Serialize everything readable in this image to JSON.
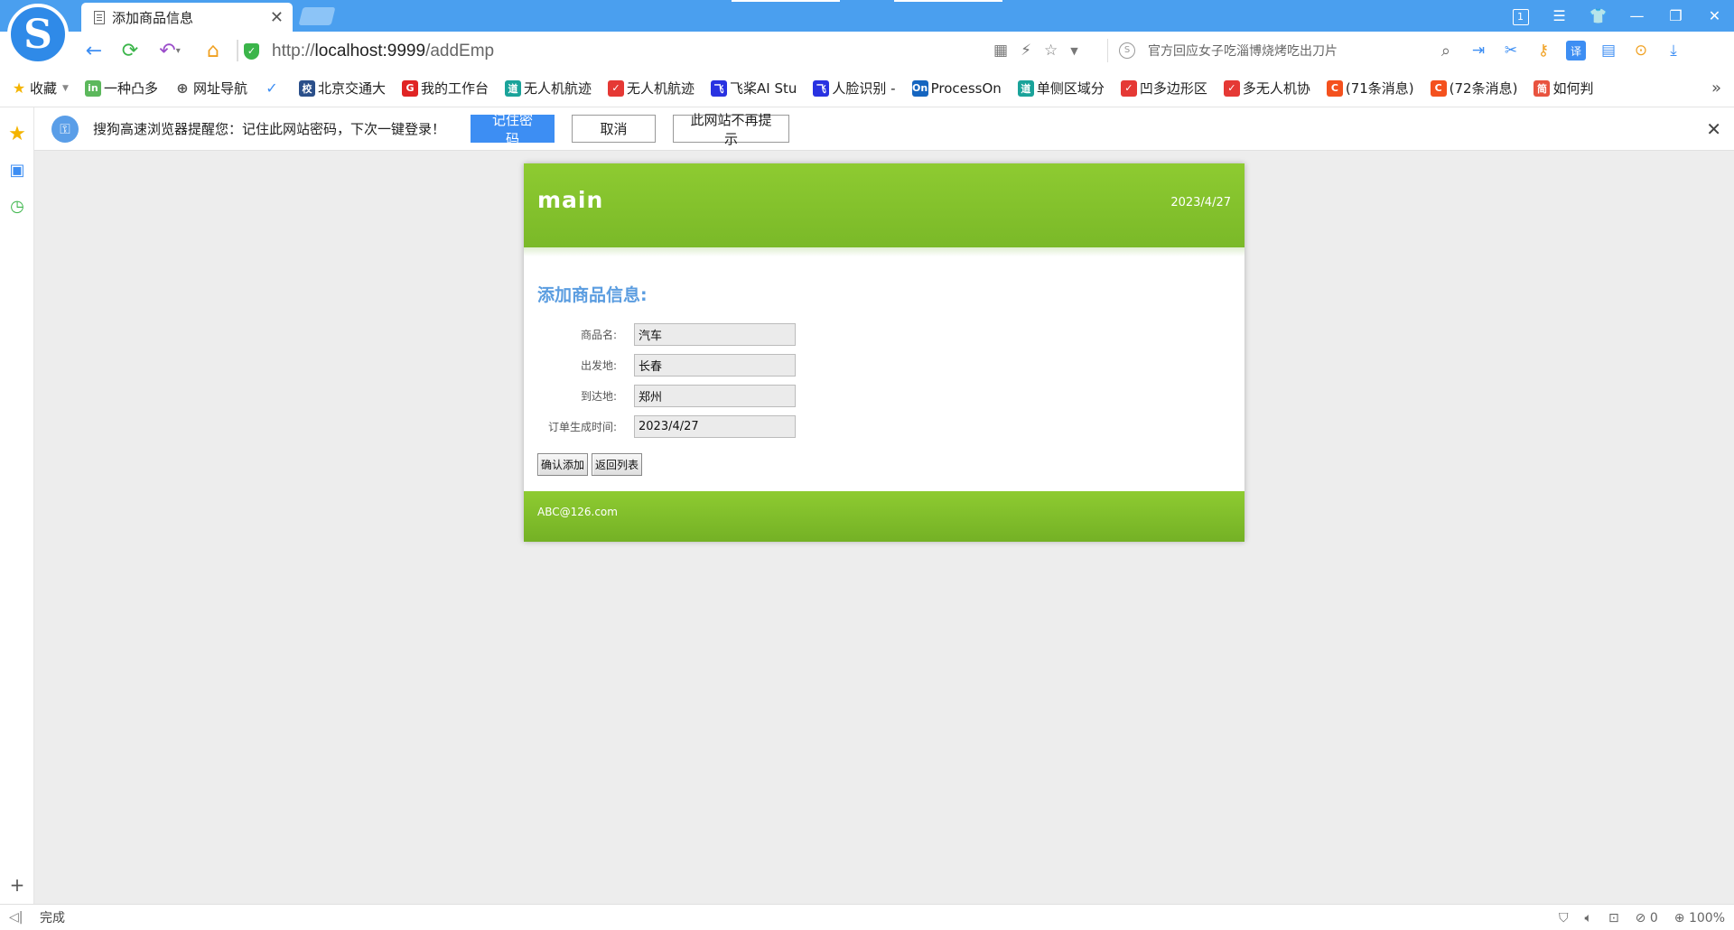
{
  "browser": {
    "tab_title": "添加商品信息",
    "url_prefix": "http://",
    "url_host": "localhost:9999",
    "url_path": "/addEmp",
    "search_placeholder": "官方回应女子吃淄博烧烤吃出刀片",
    "window_badge": "1"
  },
  "bookmarks": [
    {
      "label": "收藏",
      "icon": "star-icon",
      "color": "#f4b400"
    },
    {
      "label": "一种凸多",
      "icon": "in-icon",
      "color": "#5cb85c"
    },
    {
      "label": "网址导航",
      "icon": "globe-icon",
      "color": "#555555"
    },
    {
      "label": "",
      "icon": "check-icon",
      "color": "#3d8ef3"
    },
    {
      "label": "北京交通大",
      "icon": "university-icon",
      "color": "#2a4f8a"
    },
    {
      "label": "我的工作台",
      "icon": "workbench-icon",
      "color": "#e02424"
    },
    {
      "label": "无人机航迹",
      "icon": "doc-icon",
      "color": "#1aa39a"
    },
    {
      "label": "无人机航迹",
      "icon": "csdn-icon",
      "color": "#e53935"
    },
    {
      "label": "飞桨AI Stu",
      "icon": "paddle-icon",
      "color": "#2932e1"
    },
    {
      "label": "人脸识别 -",
      "icon": "paddle-icon",
      "color": "#2932e1"
    },
    {
      "label": "ProcessOn",
      "icon": "on-icon",
      "color": "#1565c0"
    },
    {
      "label": "单侧区域分",
      "icon": "doc-icon",
      "color": "#1aa39a"
    },
    {
      "label": "凹多边形区",
      "icon": "csdn-icon",
      "color": "#e53935"
    },
    {
      "label": "多无人机协",
      "icon": "csdn-icon",
      "color": "#e53935"
    },
    {
      "label": "(71条消息)",
      "icon": "c-icon",
      "color": "#f4511e"
    },
    {
      "label": "(72条消息)",
      "icon": "c-icon",
      "color": "#f4511e"
    },
    {
      "label": "如何判",
      "icon": "jian-icon",
      "color": "#e8533f"
    }
  ],
  "notify": {
    "message": "搜狗高速浏览器提醒您：记住此网站密码，下次一键登录！",
    "remember_label": "记住密码",
    "cancel_label": "取消",
    "never_label": "此网站不再提示"
  },
  "page": {
    "header_title": "main",
    "header_date": "2023/4/27",
    "form_title": "添加商品信息:",
    "fields": [
      {
        "label": "商品名:",
        "value": "汽车"
      },
      {
        "label": "出发地:",
        "value": "长春"
      },
      {
        "label": "到达地:",
        "value": "郑州"
      },
      {
        "label": "订单生成时间:",
        "value": "2023/4/27"
      }
    ],
    "confirm_label": "确认添加",
    "back_label": "返回列表",
    "footer_email": "ABC@126.com"
  },
  "status": {
    "text": "完成",
    "ad_count": "0",
    "zoom": "100%"
  },
  "colors": {
    "accent": "#4a9fef",
    "header_green": "#85c22d",
    "form_title": "#5b9de0",
    "primary_button": "#3d8ef3"
  }
}
